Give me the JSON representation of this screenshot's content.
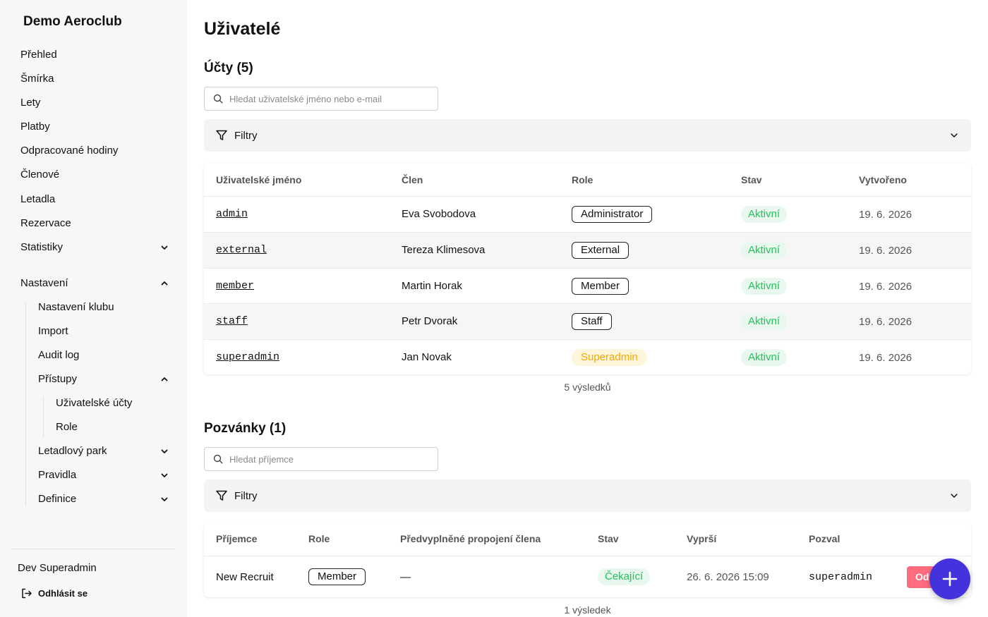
{
  "app": {
    "club_name": "Demo Aeroclub"
  },
  "sidebar": {
    "items": [
      {
        "label": "Přehled"
      },
      {
        "label": "Šmírka"
      },
      {
        "label": "Lety"
      },
      {
        "label": "Platby"
      },
      {
        "label": "Odpracované hodiny"
      },
      {
        "label": "Členové"
      },
      {
        "label": "Letadla"
      },
      {
        "label": "Rezervace"
      },
      {
        "label": "Statistiky",
        "expanded": false
      }
    ],
    "settings": {
      "label": "Nastavení",
      "expanded": true,
      "children": [
        {
          "label": "Nastavení klubu"
        },
        {
          "label": "Import"
        },
        {
          "label": "Audit log"
        },
        {
          "label": "Přístupy",
          "expanded": true
        },
        {
          "label": "Letadlový park",
          "expanded": false
        },
        {
          "label": "Pravidla",
          "expanded": false
        },
        {
          "label": "Definice",
          "expanded": false
        }
      ],
      "access_children": [
        {
          "label": "Uživatelské účty",
          "active": true
        },
        {
          "label": "Role"
        }
      ]
    },
    "user_name": "Dev Superadmin",
    "logout_label": "Odhlásit se"
  },
  "page": {
    "title": "Uživatelé"
  },
  "accounts": {
    "title": "Účty (5)",
    "search_placeholder": "Hledat uživatelské jméno nebo e-mail",
    "filters_label": "Filtry",
    "columns": [
      "Uživatelské jméno",
      "Člen",
      "Role",
      "Stav",
      "Vytvořeno"
    ],
    "rows": [
      {
        "username": "admin",
        "member": "Eva Svobodova",
        "role": "Administrator",
        "role_style": "outline",
        "status": "Aktivní",
        "created": "19. 6. 2026"
      },
      {
        "username": "external",
        "member": "Tereza Klimesova",
        "role": "External",
        "role_style": "outline",
        "status": "Aktivní",
        "created": "19. 6. 2026"
      },
      {
        "username": "member",
        "member": "Martin Horak",
        "role": "Member",
        "role_style": "outline",
        "status": "Aktivní",
        "created": "19. 6. 2026"
      },
      {
        "username": "staff",
        "member": "Petr Dvorak",
        "role": "Staff",
        "role_style": "outline",
        "status": "Aktivní",
        "created": "19. 6. 2026"
      },
      {
        "username": "superadmin",
        "member": "Jan Novak",
        "role": "Superadmin",
        "role_style": "yellow",
        "status": "Aktivní",
        "created": "19. 6. 2026"
      }
    ],
    "count": "5 výsledků"
  },
  "invitations": {
    "title": "Pozvánky (1)",
    "search_placeholder": "Hledat příjemce",
    "filters_label": "Filtry",
    "columns": [
      "Příjemce",
      "Role",
      "Předvyplněné propojení člena",
      "Stav",
      "Vyprší",
      "Pozval"
    ],
    "rows": [
      {
        "recipient": "New Recruit",
        "role": "Member",
        "member_link": "—",
        "status": "Čekající",
        "expires": "26. 6. 2026 15:09",
        "invited_by": "superadmin",
        "action_label": "Odv"
      }
    ],
    "count": "1 výsledek"
  },
  "colors": {
    "accent": "#4433dd",
    "success": "#1cc45a",
    "warning": "#f2a900",
    "danger": "#ff6b7f"
  },
  "icons": [
    "chevron-down-icon",
    "chevron-up-icon",
    "search-icon",
    "filter-icon",
    "logout-icon",
    "plus-icon"
  ]
}
